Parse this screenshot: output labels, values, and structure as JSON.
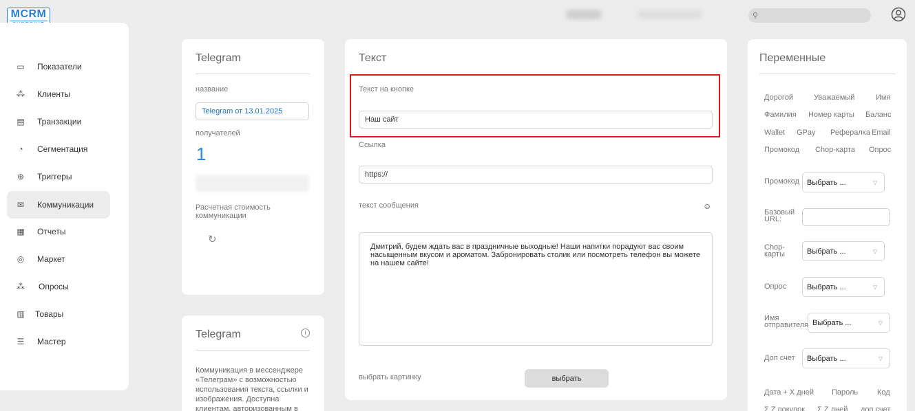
{
  "logo": {
    "line1": "MCRM",
    "line2": "SUPERKIT"
  },
  "header": {
    "search_placeholder": "",
    "avatar_icon": "user-circle-icon"
  },
  "sidebar": {
    "items": [
      {
        "label": "Показатели",
        "icon": "monitor-icon"
      },
      {
        "label": "Клиенты",
        "icon": "users-icon"
      },
      {
        "label": "Транзакции",
        "icon": "card-icon"
      },
      {
        "label": "Сегментация",
        "icon": "pie-icon"
      },
      {
        "label": "Триггеры",
        "icon": "target-icon"
      },
      {
        "label": "Коммуникации",
        "icon": "mail-icon",
        "active": true
      },
      {
        "label": "Отчеты",
        "icon": "report-icon"
      },
      {
        "label": "Маркет",
        "icon": "market-icon"
      },
      {
        "label": "Опросы",
        "icon": "poll-icon"
      },
      {
        "label": "Товары",
        "icon": "bag-icon"
      },
      {
        "label": "Мастер",
        "icon": "sliders-icon"
      }
    ]
  },
  "telegram_card": {
    "title": "Telegram",
    "name_label": "название",
    "name_value": "Telegram от 13.01.2025",
    "recipients_label": "получателей",
    "recipients_count": "1",
    "cost_label": "Расчетная стоимость коммуникации"
  },
  "info_card": {
    "title": "Telegram",
    "text": "Коммуникация в мессенджере «Телеграм» с возможностью использования текста, ссылки и изображения. Доступна клиентам, авторизованным в"
  },
  "text_card": {
    "title": "Текст",
    "button_text_label": "Текст на кнопке",
    "button_text_value": "Наш сайт",
    "link_label": "Ссылка",
    "link_value": "https://",
    "message_label": "текст сообщения",
    "message_value": "Дмитрий, будем ждать вас в праздничные выходные! Наши напитки порадуют вас своим насыщенным вкусом и ароматом. Забронировать столик или посмотреть телефон вы можете на нашем сайте!",
    "image_label": "выбрать картинку",
    "image_button": "выбрать",
    "highlight_color": "#e0161b"
  },
  "vars_card": {
    "title": "Переменные",
    "rows": [
      [
        "Дорогой",
        "Уважаемый",
        "Имя"
      ],
      [
        "Фамилия",
        "Номер карты",
        "Баланс"
      ],
      [
        "Wallet",
        "GPay",
        "Рефералка",
        "Email"
      ],
      [
        "Промокод",
        "Chop-карта",
        "Опрос"
      ]
    ],
    "promocode_label": "Промокод",
    "base_url_label": "Базовый URL:",
    "chop_label": "Chop-карты",
    "poll_label": "Опрос",
    "sender_label": "Имя отправителя",
    "extra_label": "Доп счет",
    "select_value": "Выбрать ...",
    "bottom_row1": [
      "Дата + X дней",
      "Пароль",
      "Код"
    ],
    "bottom_row2": [
      "Σ Z покупок",
      "Σ Z дней",
      "доп счет"
    ]
  },
  "colors": {
    "accent": "#2b7fd0",
    "background": "#ececec"
  }
}
